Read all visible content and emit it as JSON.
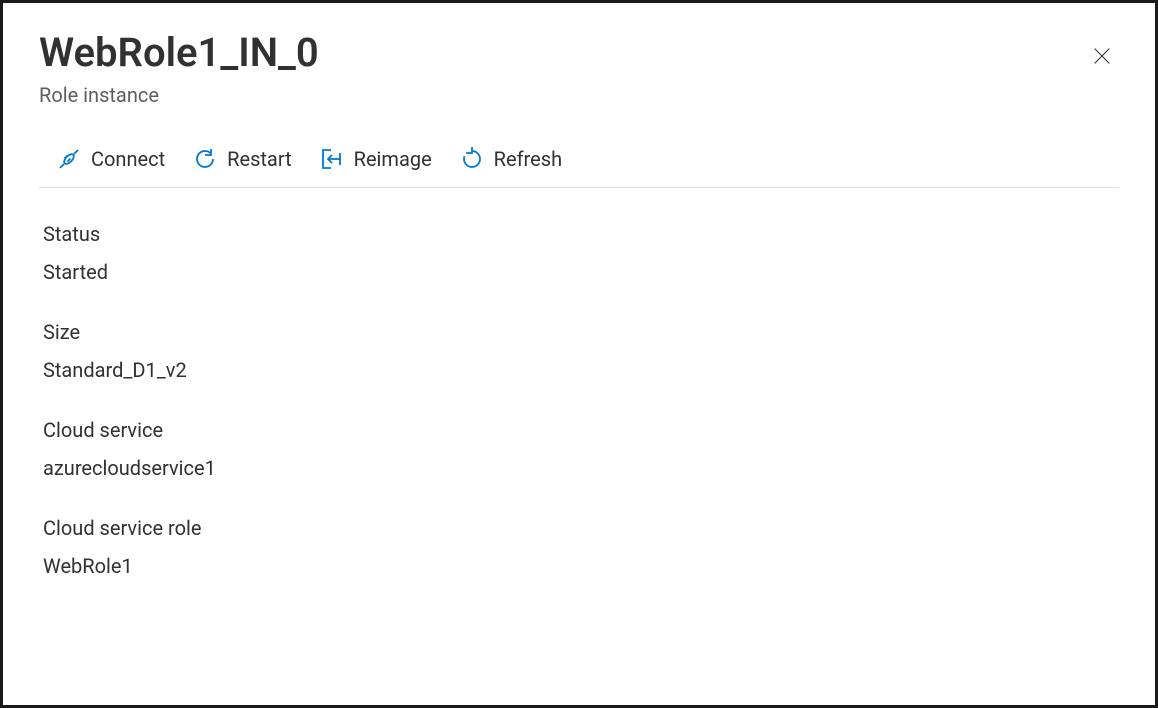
{
  "header": {
    "title": "WebRole1_IN_0",
    "subtitle": "Role instance"
  },
  "toolbar": {
    "connect": "Connect",
    "restart": "Restart",
    "reimage": "Reimage",
    "refresh": "Refresh"
  },
  "fields": {
    "status": {
      "label": "Status",
      "value": "Started"
    },
    "size": {
      "label": "Size",
      "value": "Standard_D1_v2"
    },
    "cloudService": {
      "label": "Cloud service",
      "value": "azurecloudservice1"
    },
    "cloudServiceRole": {
      "label": "Cloud service role",
      "value": "WebRole1"
    }
  }
}
